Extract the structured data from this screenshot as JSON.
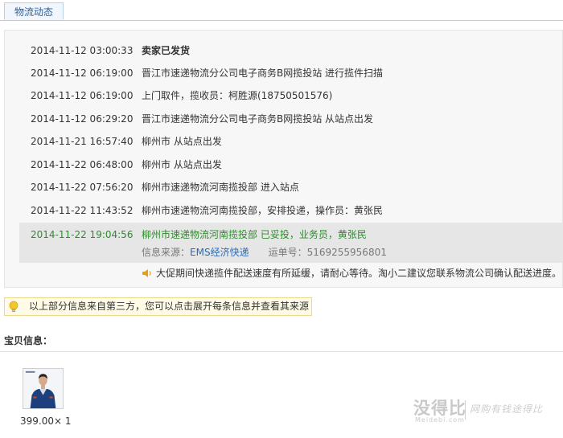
{
  "tab": {
    "label": "物流动态"
  },
  "events": [
    {
      "time": "2014-11-12 03:00:33",
      "desc": "卖家已发货"
    },
    {
      "time": "2014-11-12 06:19:00",
      "desc": "晋江市速递物流分公司电子商务B网揽投站 进行揽件扫描"
    },
    {
      "time": "2014-11-12 06:19:00",
      "desc": "上门取件，揽收员：柯胜源(18750501576)"
    },
    {
      "time": "2014-11-12 06:29:20",
      "desc": "晋江市速递物流分公司电子商务B网揽投站 从站点出发"
    },
    {
      "time": "2014-11-21 16:57:40",
      "desc": "柳州市 从站点出发"
    },
    {
      "time": "2014-11-22 06:48:00",
      "desc": "柳州市 从站点出发"
    },
    {
      "time": "2014-11-22 07:56:20",
      "desc": "柳州市速递物流河南揽投部 进入站点"
    },
    {
      "time": "2014-11-22 11:43:52",
      "desc": "柳州市速递物流河南揽投部，安排投递，操作员：黄张民"
    }
  ],
  "latest": {
    "time": "2014-11-22 19:04:56",
    "desc": "柳州市速递物流河南揽投部 已妥投，业务员，黄张民",
    "source_label": "信息来源：",
    "source_link": "EMS经济快递",
    "waybill_label": "运单号：",
    "waybill_no": "5169255956801"
  },
  "notice": "大促期间快递揽件配送速度有所延缓，请耐心等待。淘小二建议您联系物流公司确认配送进度。",
  "third_party": "以上部分信息来自第三方，您可以点击展开每条信息并查看其来源",
  "product": {
    "section_title": "宝贝信息：",
    "price_qty": "399.00× 1"
  },
  "watermark": {
    "main": "没得比",
    "domain": "Meidebi.com",
    "slogan": "网购有钱途得比"
  },
  "colors": {
    "tab_text": "#2a5f9e",
    "latest_green": "#2f8a2f",
    "link_blue": "#2a6bb8",
    "notice_bg": "#fffbe6"
  }
}
